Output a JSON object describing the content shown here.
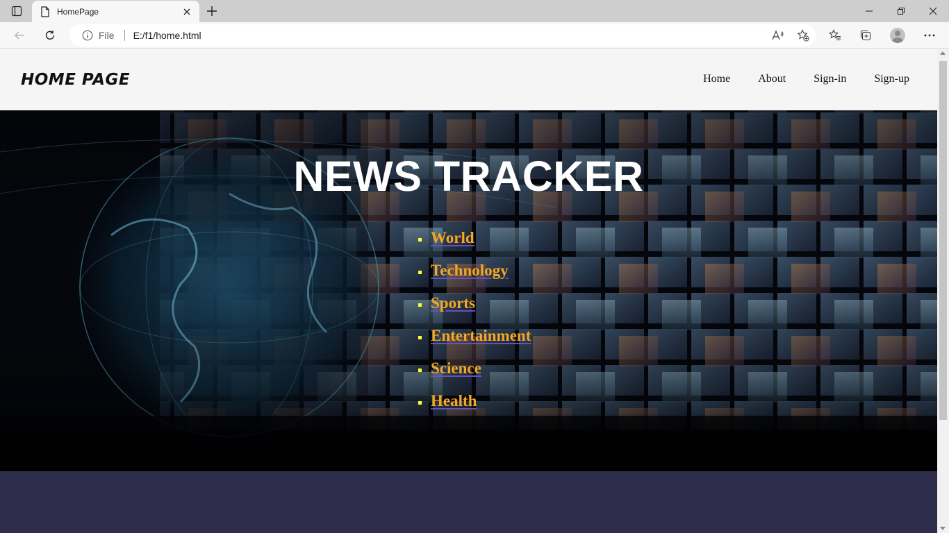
{
  "browser": {
    "tab": {
      "title": "HomePage"
    },
    "address_bar": {
      "site_info_label": "File",
      "url": "E:/f1/home.html"
    }
  },
  "site": {
    "brand": "HOME PAGE",
    "nav": [
      {
        "label": "Home"
      },
      {
        "label": "About"
      },
      {
        "label": "Sign-in"
      },
      {
        "label": "Sign-up"
      }
    ]
  },
  "hero": {
    "title": "NEWS TRACKER",
    "topics": [
      {
        "label": "World"
      },
      {
        "label": "Technology"
      },
      {
        "label": "Sports"
      },
      {
        "label": "Entertainment"
      },
      {
        "label": "Science"
      },
      {
        "label": "Health"
      }
    ]
  },
  "colors": {
    "tab_strip": "#cecece",
    "toolbar": "#f7f7f7",
    "header_bg": "#f5f5f5",
    "topic_link": "#f5a623",
    "topic_underline": "#6a4fc0",
    "bullet": "#ffff33",
    "footer_band": "#2e2d4b"
  }
}
